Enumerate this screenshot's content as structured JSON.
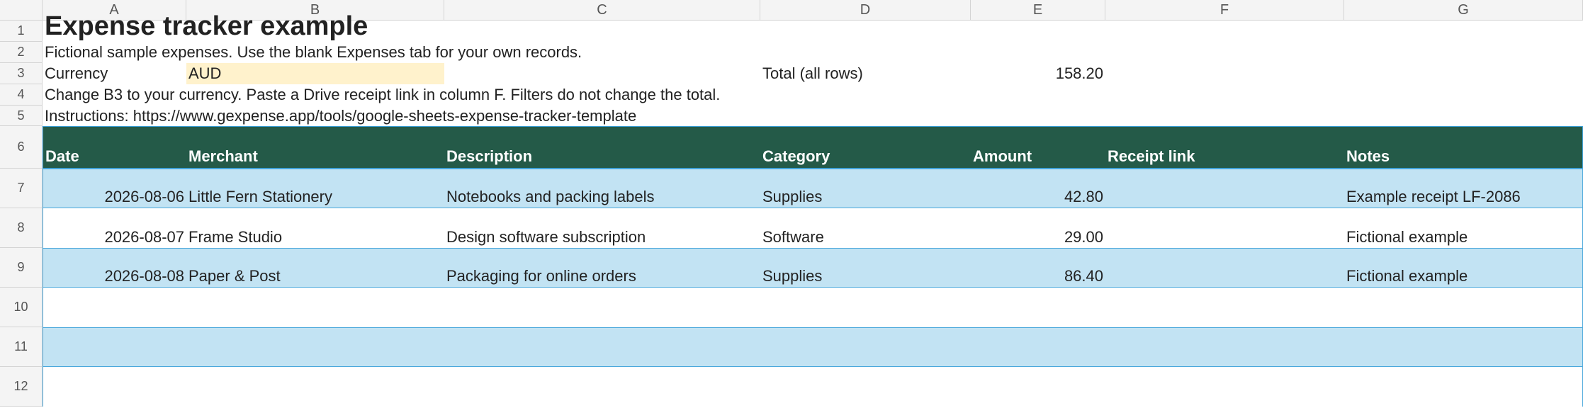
{
  "columns": [
    "A",
    "B",
    "C",
    "D",
    "E",
    "F",
    "G"
  ],
  "row_numbers": [
    "1",
    "2",
    "3",
    "4",
    "5",
    "6",
    "7",
    "8",
    "9",
    "10",
    "11",
    "12"
  ],
  "title": "Expense tracker example",
  "subtitle": "Fictional sample expenses. Use the blank Expenses tab for your own records.",
  "currency": {
    "label": "Currency",
    "value": "AUD"
  },
  "total": {
    "label": "Total (all rows)",
    "value": "158.20"
  },
  "instructions_line1": "Change B3 to your currency. Paste a Drive receipt link in column F. Filters do not change the total.",
  "instructions_line2": "Instructions: https://www.gexpense.app/tools/google-sheets-expense-tracker-template",
  "table": {
    "headers": [
      "Date",
      "Merchant",
      "Description",
      "Category",
      "Amount",
      "Receipt link",
      "Notes"
    ],
    "rows": [
      [
        "2026-08-06",
        "Little Fern Stationery",
        "Notebooks and packing labels",
        "Supplies",
        "42.80",
        "",
        "Example receipt LF-2086"
      ],
      [
        "2026-08-07",
        "Frame Studio",
        "Design software subscription",
        "Software",
        "29.00",
        "",
        "Fictional example"
      ],
      [
        "2026-08-08",
        "Paper & Post",
        "Packaging for online orders",
        "Supplies",
        "86.40",
        "",
        "Fictional example"
      ]
    ]
  },
  "colors": {
    "header_fill": "#245a48",
    "band_blue": "#c2e3f3",
    "band_border": "#4aa8dc",
    "currency_highlight": "#fff2cc"
  }
}
